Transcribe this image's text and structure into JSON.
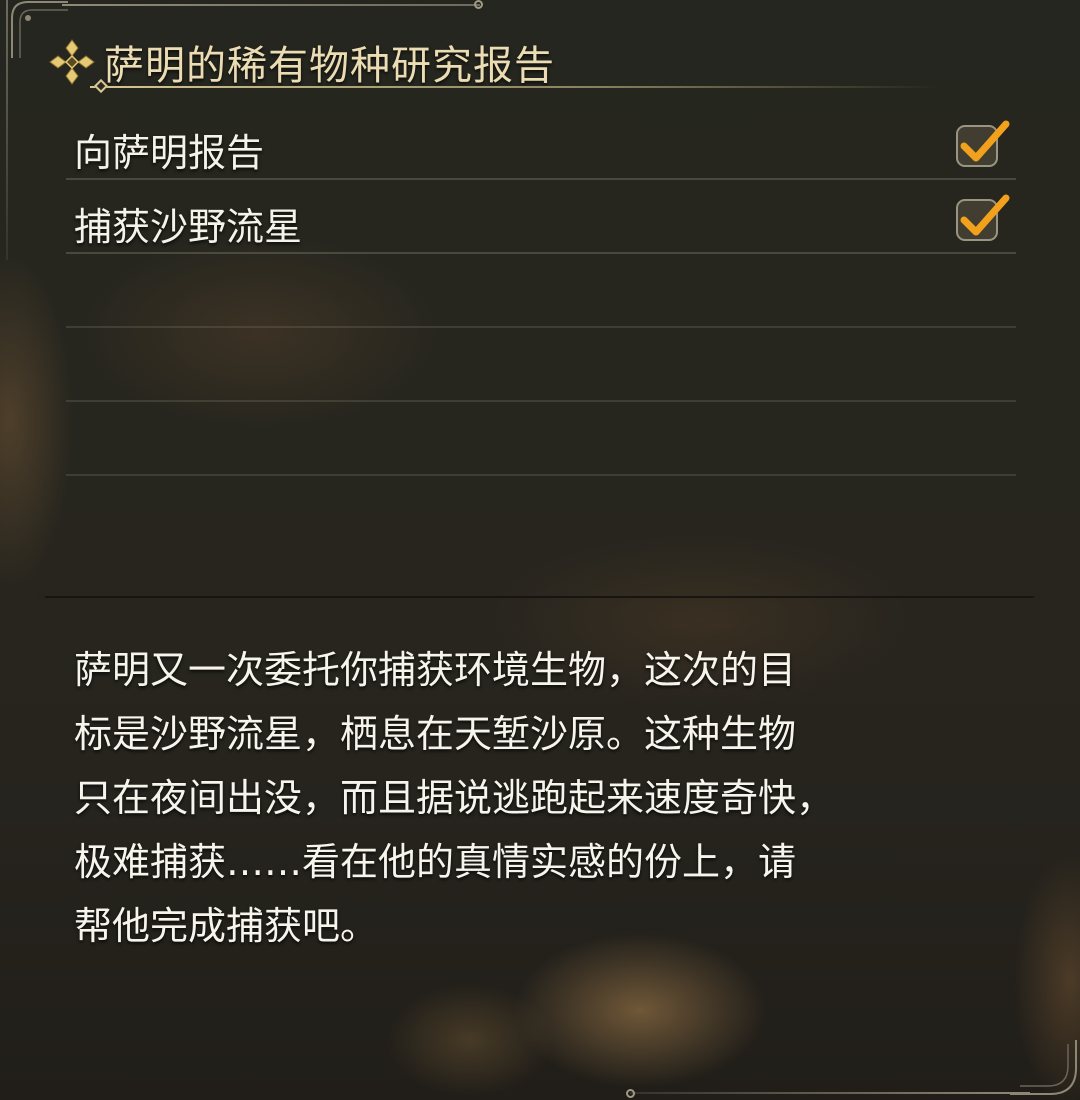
{
  "quest": {
    "title": "萨明的稀有物种研究报告",
    "objectives": [
      {
        "label": "向萨明报告",
        "completed": true
      },
      {
        "label": "捕获沙野流星",
        "completed": true
      }
    ],
    "empty_slots": 3,
    "description": "萨明又一次委托你捕获环境生物，这次的目\n标是沙野流星，栖息在天堑沙原。这种生物\n只在夜间出没，而且据说逃跑起来速度奇快，\n极难捕获……看在他的真情实感的份上，请\n帮他完成捕获吧。"
  },
  "icons": {
    "title": "ornament-diamond-icon",
    "check": "checkmark-icon"
  },
  "colors": {
    "accent_gold": "#d9c893",
    "check_orange": "#f2a11d",
    "text": "#f5f2ea"
  }
}
